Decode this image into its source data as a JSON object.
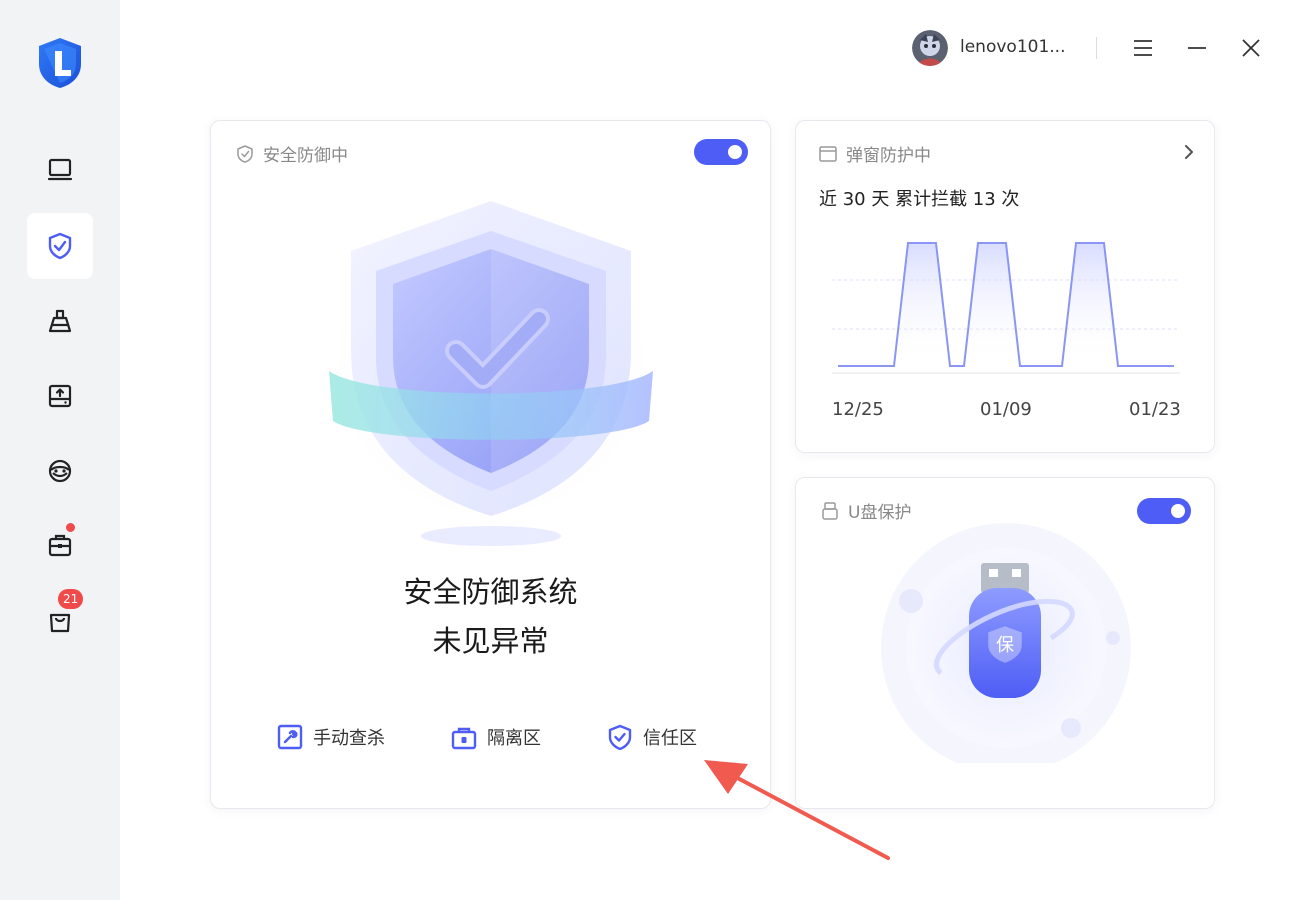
{
  "sidebar": {
    "logo": "lenovo-L-shield-logo",
    "items": [
      {
        "icon": "monitor-icon"
      },
      {
        "icon": "shield-check-icon",
        "active": true
      },
      {
        "icon": "broom-icon"
      },
      {
        "icon": "drive-upload-icon"
      },
      {
        "icon": "network-eye-icon"
      },
      {
        "icon": "toolbox-icon",
        "dot": true
      },
      {
        "icon": "shopping-bag-icon",
        "badge": "21"
      }
    ]
  },
  "header": {
    "username": "lenovo101...",
    "menu_icon": "menu-icon",
    "minimize_icon": "minimize-icon",
    "close_icon": "close-icon"
  },
  "defense": {
    "title": "安全防御中",
    "toggle_on": true,
    "status_line1": "安全防御系统",
    "status_line2": "未见异常",
    "actions": [
      {
        "label": "手动查杀",
        "icon": "wrench-box-icon"
      },
      {
        "label": "隔离区",
        "icon": "lock-box-icon"
      },
      {
        "label": "信任区",
        "icon": "trust-shield-icon"
      }
    ]
  },
  "popup": {
    "title": "弹窗防护中",
    "summary": "近 30 天 累计拦截 13 次",
    "chart_data": {
      "type": "area",
      "x_ticks": [
        "12/25",
        "01/09",
        "01/23"
      ],
      "series": [
        {
          "points": [
            [
              "12/25",
              0
            ],
            [
              "12/26",
              0
            ],
            [
              "12/27",
              0
            ],
            [
              "12/28",
              0
            ],
            [
              "12/29",
              0
            ],
            [
              "12/31",
              1
            ],
            [
              "01/01",
              1
            ],
            [
              "01/02",
              1
            ],
            [
              "01/04",
              0
            ],
            [
              "01/05",
              0
            ],
            [
              "01/06",
              1
            ],
            [
              "01/07",
              1
            ],
            [
              "01/08",
              1
            ],
            [
              "01/10",
              0
            ],
            [
              "01/11",
              0
            ],
            [
              "01/12",
              0
            ],
            [
              "01/13",
              0
            ],
            [
              "01/15",
              1
            ],
            [
              "01/16",
              1
            ],
            [
              "01/17",
              1
            ],
            [
              "01/19",
              0
            ],
            [
              "01/20",
              0
            ],
            [
              "01/21",
              0
            ],
            [
              "01/22",
              0
            ],
            [
              "01/23",
              0
            ]
          ]
        }
      ],
      "grid": true,
      "color": "#8a95f5"
    }
  },
  "usb": {
    "title": "U盘保护",
    "toggle_on": true,
    "usb_label": "保"
  },
  "colors": {
    "accent": "#4e5df5",
    "badge": "#f04a4a",
    "sidebar_bg": "#f2f3f5",
    "annotation_arrow": "#f05a4f"
  }
}
